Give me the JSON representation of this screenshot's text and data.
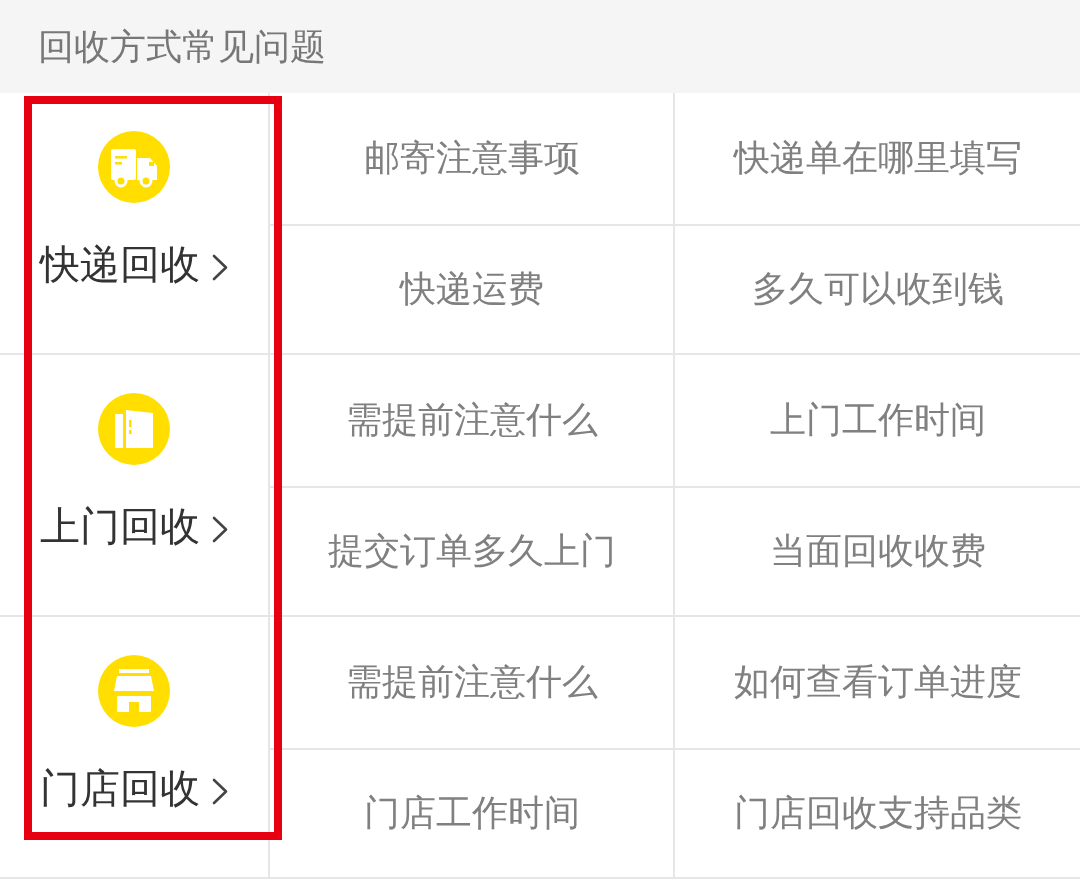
{
  "header": {
    "title": "回收方式常见问题"
  },
  "categories_highlighted": true,
  "sections": [
    {
      "kind": "courier",
      "label": "快递回收",
      "questions": [
        "邮寄注意事项",
        "快递单在哪里填写",
        "快递运费",
        "多久可以收到钱"
      ]
    },
    {
      "kind": "doorstep",
      "label": "上门回收",
      "questions": [
        "需提前注意什么",
        "上门工作时间",
        "提交订单多久上门",
        "当面回收收费"
      ]
    },
    {
      "kind": "store",
      "label": "门店回收",
      "questions": [
        "需提前注意什么",
        "如何查看订单进度",
        "门店工作时间",
        "门店回收支持品类"
      ]
    }
  ]
}
